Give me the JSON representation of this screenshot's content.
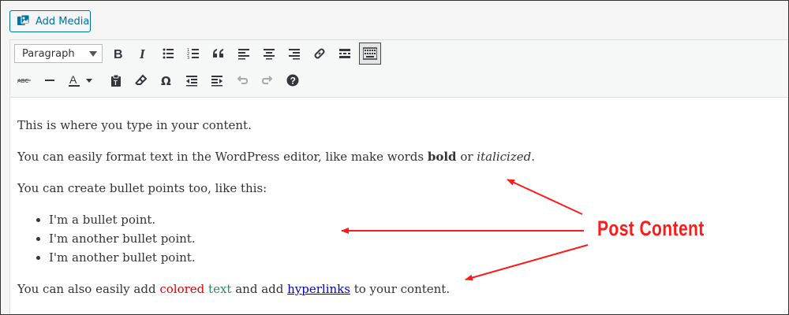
{
  "media": {
    "add_media_label": "Add Media"
  },
  "toolbar": {
    "format_value": "Paragraph",
    "row1_icons": [
      "bold-icon",
      "italic-icon",
      "bulleted-list-icon",
      "numbered-list-icon",
      "blockquote-icon",
      "align-left-icon",
      "align-center-icon",
      "align-right-icon",
      "link-icon",
      "read-more-icon",
      "toolbar-toggle-icon"
    ],
    "row2_icons": [
      "strikethrough-icon",
      "horizontal-line-icon",
      "text-color-icon",
      "paste-as-text-icon",
      "clear-formatting-icon",
      "special-character-icon",
      "outdent-icon",
      "indent-icon",
      "undo-icon",
      "redo-icon",
      "help-icon"
    ]
  },
  "content": {
    "p1": "This is where you type in your content.",
    "p2_before": "You can easily format text in the WordPress editor, like make words ",
    "p2_bold": "bold",
    "p2_mid": " or ",
    "p2_italic": "italicized",
    "p2_end": ".",
    "p3": "You can create bullet points too, like this:",
    "bullets": [
      "I'm a bullet point.",
      "I'm another bullet point.",
      "I'm another bullet point."
    ],
    "p4_before": "You can also easily add ",
    "p4_colored": "colored",
    "p4_space": " ",
    "p4_text": "text",
    "p4_mid": " and add ",
    "p4_link": "hyperlinks",
    "p4_end": " to your content."
  },
  "annotation": {
    "label": "Post Content",
    "color": "#ff1a1a"
  },
  "colors": {
    "accent": "#0071a1",
    "red_text": "#e30000",
    "green_text": "#2e8b57",
    "link": "#0000cc"
  }
}
